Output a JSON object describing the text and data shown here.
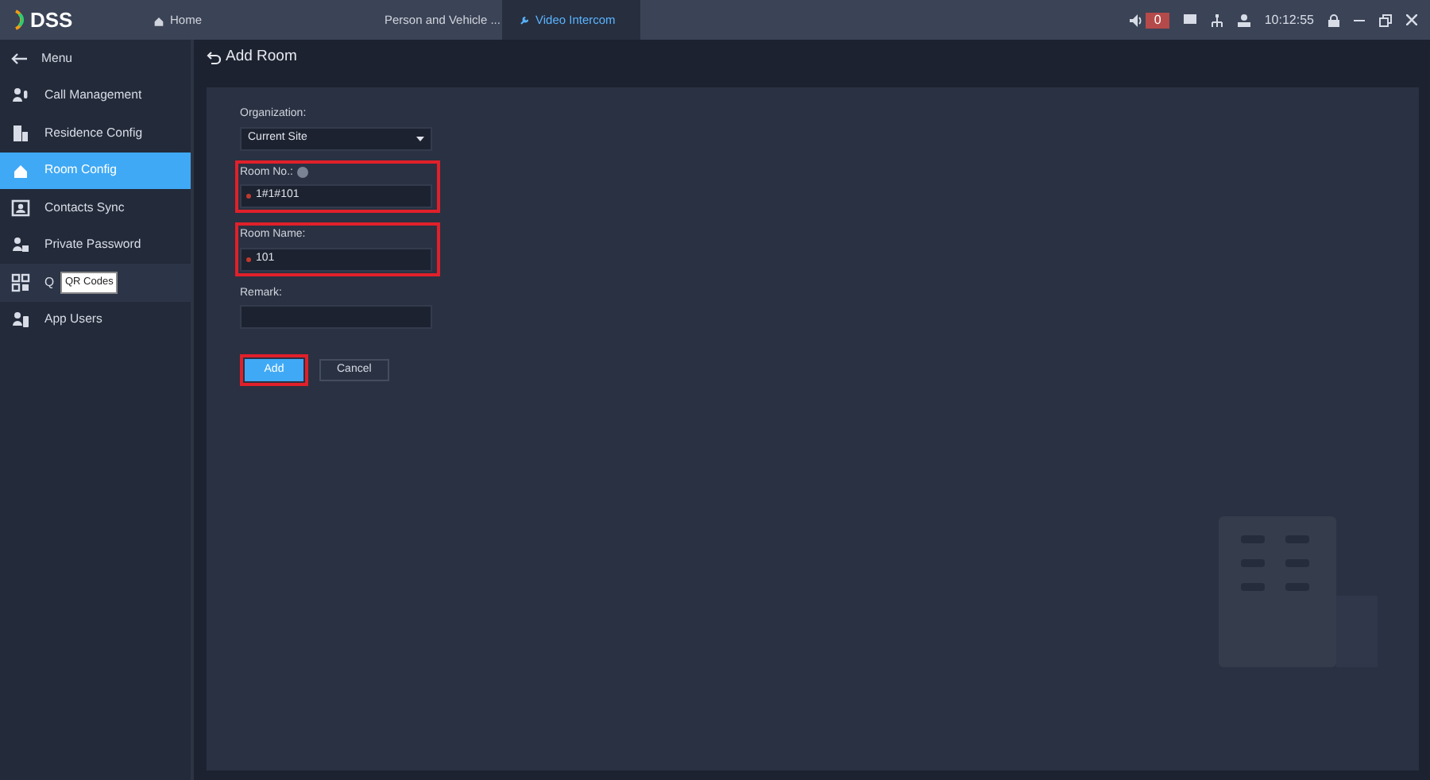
{
  "app": {
    "logo": "DSS"
  },
  "tabs": [
    {
      "label": "Home",
      "selected": false
    },
    {
      "label": "Person and Vehicle ...",
      "selected": false
    },
    {
      "label": "Video Intercom",
      "selected": true
    }
  ],
  "status": {
    "alarm_count": "0",
    "time": "10:12:55"
  },
  "sidebar": {
    "title": "Menu",
    "items": [
      {
        "label": "Call Management",
        "selected": false
      },
      {
        "label": "Residence Config",
        "selected": false
      },
      {
        "label": "Room Config",
        "selected": true
      },
      {
        "label": "Contacts Sync",
        "selected": false
      },
      {
        "label": "Private Password",
        "selected": false
      },
      {
        "label": "Q",
        "selected": false,
        "tooltip": "QR Codes"
      },
      {
        "label": "App Users",
        "selected": false
      }
    ]
  },
  "page": {
    "title": "Add Room"
  },
  "form": {
    "fields": [
      {
        "kind": "select",
        "label": "Organization:",
        "value": "Current Site",
        "required": false,
        "info": false,
        "highlighted": false
      },
      {
        "kind": "text",
        "label": "Room No.:",
        "value": "1#1#101",
        "required": true,
        "info": true,
        "highlighted": true
      },
      {
        "kind": "text",
        "label": "Room Name:",
        "value": "101",
        "required": true,
        "info": false,
        "highlighted": true
      },
      {
        "kind": "text",
        "label": "Remark:",
        "required": false,
        "info": false,
        "highlighted": false
      }
    ],
    "buttons": [
      {
        "label": "Add",
        "kind": "primary",
        "highlighted": true
      },
      {
        "label": "Cancel",
        "kind": "secondary",
        "highlighted": false
      }
    ]
  }
}
